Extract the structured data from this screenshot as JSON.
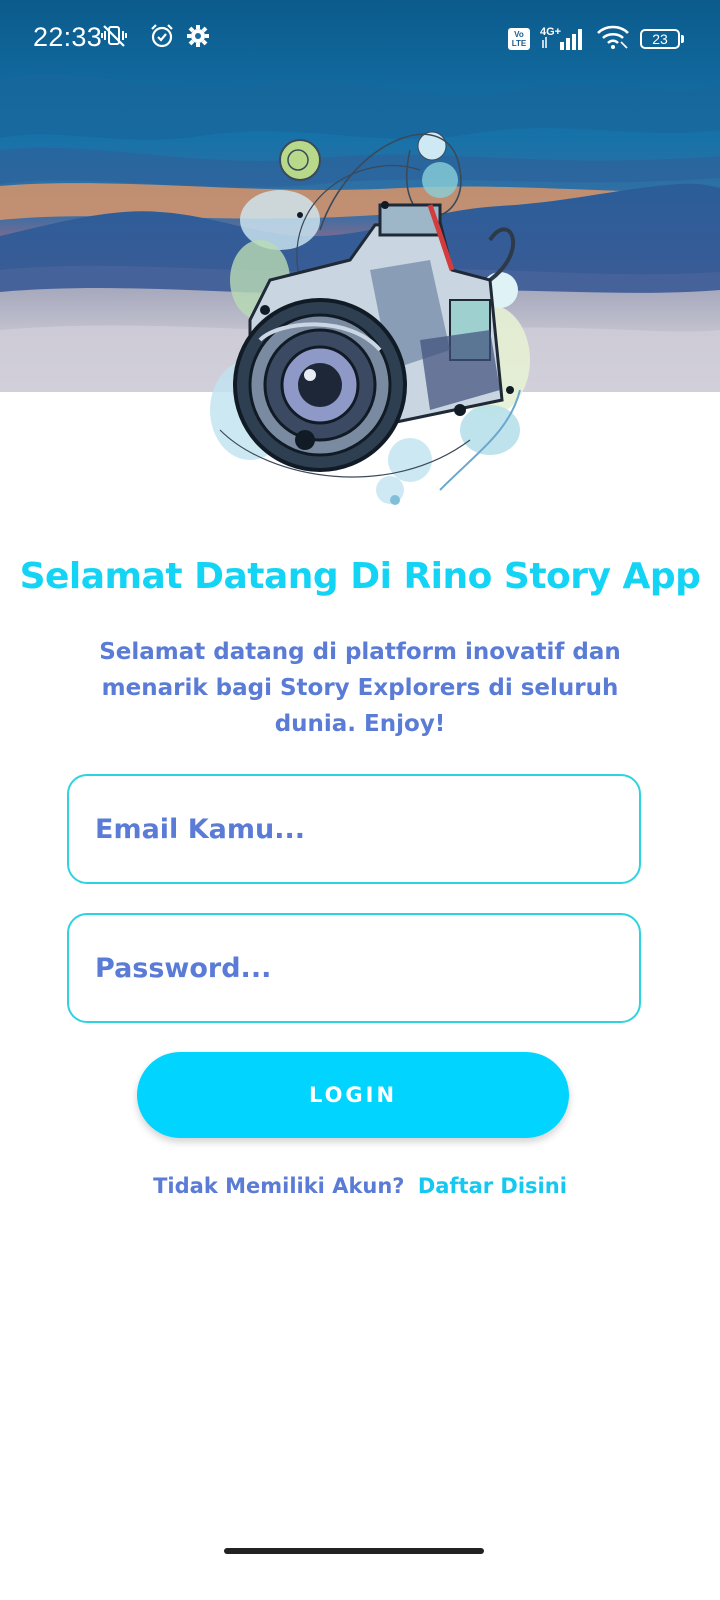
{
  "status_bar": {
    "time": "22:33",
    "volte_top": "Vo",
    "volte_bottom": "LTE",
    "network": "4G+",
    "battery": "23",
    "icons": [
      "vibrate-mute-icon",
      "alarm-icon",
      "settings-gear-icon",
      "volte-icon",
      "signal-icon",
      "wifi-icon",
      "battery-icon"
    ]
  },
  "header": {
    "image": "landscape-sunset-with-camera-illustration"
  },
  "welcome": {
    "title": "Selamat Datang Di Rino Story App",
    "subtitle": "Selamat datang di platform inovatif dan menarik bagi Story Explorers di seluruh dunia. Enjoy!"
  },
  "form": {
    "email_placeholder": "Email Kamu...",
    "password_placeholder": "Password...",
    "login_label": "LOGIN"
  },
  "register": {
    "question": "Tidak Memiliki Akun?",
    "link": "Daftar Disini"
  },
  "colors": {
    "title": "#14d4f5",
    "body_text": "#5a7bd6",
    "input_border": "#2ed3df",
    "button": "#00d4ff",
    "link": "#14c8ef"
  }
}
